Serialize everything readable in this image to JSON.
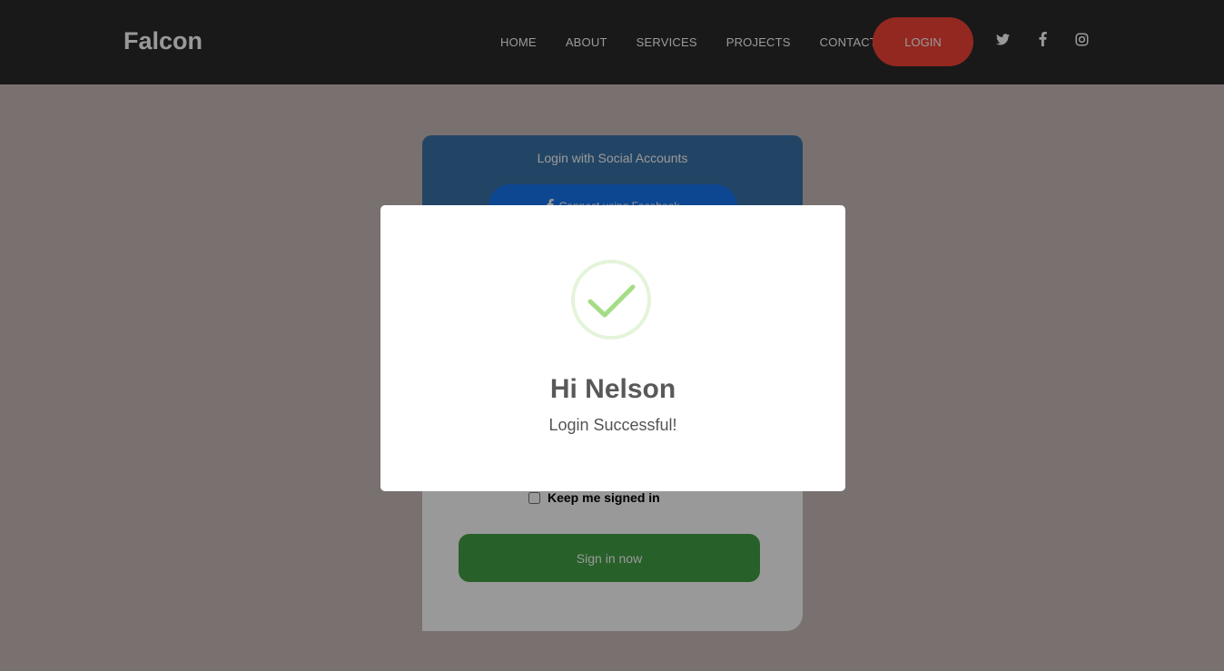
{
  "navbar": {
    "brand": "Falcon",
    "links": [
      "HOME",
      "ABOUT",
      "SERVICES",
      "PROJECTS",
      "CONTACT"
    ],
    "login_label": "LOGIN",
    "social_icons": [
      "twitter-icon",
      "facebook-icon",
      "instagram-icon"
    ]
  },
  "login_card": {
    "social_title": "Login with Social Accounts",
    "facebook_button": "Connect using Facebook",
    "keep_signed_in": "Keep me signed in",
    "signin_button": "Sign in now"
  },
  "modal": {
    "icon": "check-circle-icon",
    "title": "Hi Nelson",
    "message": "Login Successful!"
  },
  "colors": {
    "navbar_bg": "#2b2b2b",
    "login_button": "#f44336",
    "card_header": "#3b73a8",
    "facebook_button": "#1877f2",
    "signin_button": "#43a047",
    "success_check": "#a5dc86"
  }
}
